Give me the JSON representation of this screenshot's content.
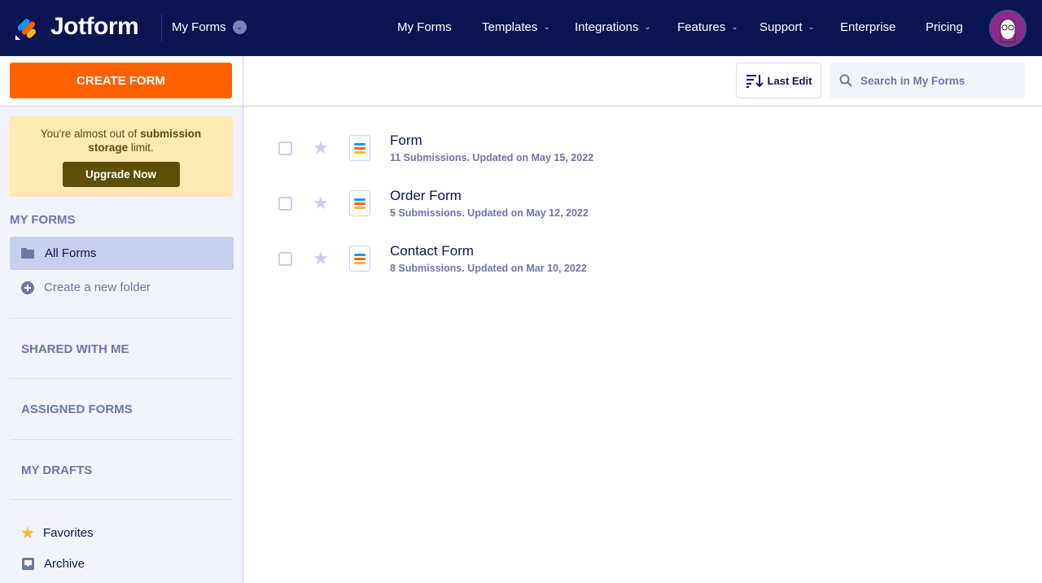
{
  "nav": {
    "brand": "Jotform",
    "context_dropdown": "My Forms",
    "items": [
      {
        "label": "My Forms",
        "dropdown": false
      },
      {
        "label": "Templates",
        "dropdown": true
      },
      {
        "label": "Integrations",
        "dropdown": true
      },
      {
        "label": "Features",
        "dropdown": true
      },
      {
        "label": "Support",
        "dropdown": true
      },
      {
        "label": "Enterprise",
        "dropdown": false
      },
      {
        "label": "Pricing",
        "dropdown": false
      }
    ]
  },
  "sidebar": {
    "create_button": "CREATE FORM",
    "warning": {
      "pre": "You're almost out of ",
      "bold1": "submission",
      "bold2": "storage",
      "post": " limit.",
      "button": "Upgrade Now"
    },
    "my_forms_heading": "MY FORMS",
    "all_forms": "All Forms",
    "create_folder": "Create a new folder",
    "sections": [
      "SHARED WITH ME",
      "ASSIGNED FORMS",
      "MY DRAFTS"
    ],
    "favorites": "Favorites",
    "archive": "Archive"
  },
  "toolbar": {
    "sort_label": "Last Edit",
    "search_placeholder": "Search in My Forms"
  },
  "forms": [
    {
      "title": "Form",
      "meta": "11 Submissions. Updated on May 15, 2022"
    },
    {
      "title": "Order Form",
      "meta": "5 Submissions. Updated on May 12, 2022"
    },
    {
      "title": "Contact Form",
      "meta": "8 Submissions. Updated on Mar 10, 2022"
    }
  ],
  "colors": {
    "nav_bg": "#0a1551",
    "accent": "#ff6100",
    "muted": "#6f76a7"
  }
}
